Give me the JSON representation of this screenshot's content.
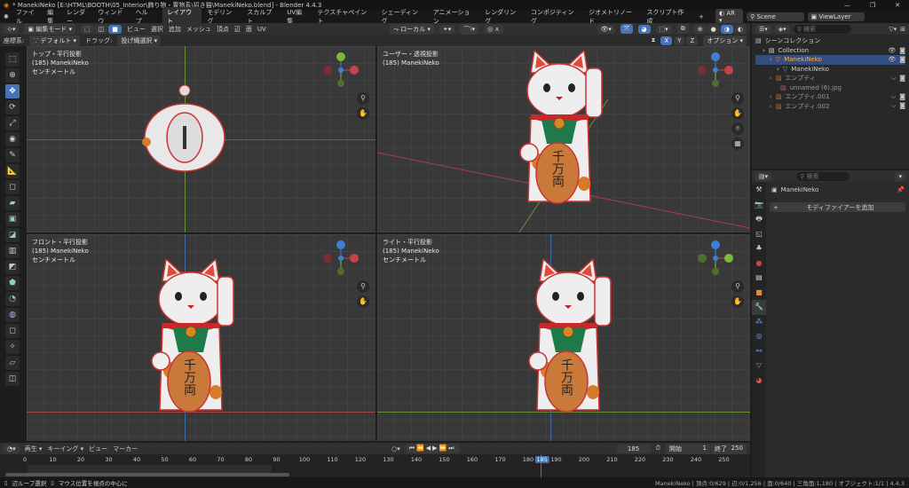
{
  "window": {
    "title": "* ManekiNeko [E:\\HTML\\BOOTH\\05_Interior\\飾り物・置物系\\招き猫\\ManekiNeko.blend] - Blender 4.4.3",
    "controls": [
      "—",
      "❐",
      "✕"
    ]
  },
  "menu": [
    "ファイル",
    "編集",
    "レンダー",
    "ウィンドウ",
    "ヘルプ"
  ],
  "workspaces": [
    "レイアウト",
    "モデリング",
    "スカルプト",
    "UV編集",
    "テクスチャペイント",
    "シェーディング",
    "アニメーション",
    "レンダリング",
    "コンポジティング",
    "ジオメトリノード",
    "スクリプト作成",
    "+"
  ],
  "active_workspace": 0,
  "scene": {
    "render_engine": "AR",
    "scene_name": "Scene",
    "view_layer": "ViewLayer"
  },
  "viewport_header": {
    "mode": "編集モード",
    "menus": [
      "ビュー",
      "選択",
      "追加",
      "メッシュ",
      "頂点",
      "辺",
      "面",
      "UV"
    ],
    "pivot": "ローカル",
    "coord_label": "座標系:",
    "coord_value": "デフォルト",
    "drag_label": "ドラッグ:",
    "drag_value": "投げ縄選択",
    "axes": [
      "X",
      "Y",
      "Z"
    ],
    "options": "オプション"
  },
  "viewports": [
    {
      "name": "トップ・平行投影",
      "object": "(185) ManekiNeko",
      "units": "センチメートル"
    },
    {
      "name": "ユーザー・透視投影",
      "object": "(185) ManekiNeko",
      "units": ""
    },
    {
      "name": "フロント・平行投影",
      "object": "(185) ManekiNeko",
      "units": "センチメートル"
    },
    {
      "name": "ライト・平行投影",
      "object": "(185) ManekiNeko",
      "units": "センチメートル"
    }
  ],
  "cat_text": "千万両",
  "outliner": {
    "search_placeholder": "検索",
    "scene_collection": "シーンコレクション",
    "items": [
      {
        "label": "Collection",
        "indent": 1
      },
      {
        "label": "ManekiNeko",
        "indent": 2,
        "selected": true
      },
      {
        "label": "ManekiNeko",
        "indent": 3
      },
      {
        "label": "エンプティ",
        "indent": 2
      },
      {
        "label": "unnamed (6).jpg",
        "indent": 3
      },
      {
        "label": "エンプティ.001",
        "indent": 2
      },
      {
        "label": "エンプティ.002",
        "indent": 2
      }
    ]
  },
  "properties": {
    "search_placeholder": "検索",
    "object_name": "ManekiNeko",
    "add_modifier": "モディファイアーを追加"
  },
  "timeline": {
    "menus": [
      "再生",
      "キーイング",
      "ビュー",
      "マーカー"
    ],
    "current_frame": "185",
    "start_label": "開始",
    "start": "1",
    "end_label": "終了",
    "end": "250",
    "ticks": [
      "0",
      "10",
      "20",
      "30",
      "40",
      "50",
      "60",
      "70",
      "80",
      "90",
      "100",
      "110",
      "120",
      "130",
      "140",
      "150",
      "160",
      "170",
      "180",
      "185",
      "190",
      "200",
      "210",
      "220",
      "230",
      "240",
      "250"
    ]
  },
  "status": {
    "hint1": "辺ループ選択",
    "hint2": "マウス位置を視点の中心に",
    "stats": "ManekiNeko | 頂点:0/629 | 辺:0/1,256 | 面:0/640 | 三角面:1,180 | オブジェクト:1/1 | 4.4.3"
  },
  "colors": {
    "accent": "#4772b3",
    "x_axis": "#c8414b",
    "y_axis": "#7fb83b",
    "z_axis": "#3f7fd6",
    "outline": "#d33b2b"
  }
}
